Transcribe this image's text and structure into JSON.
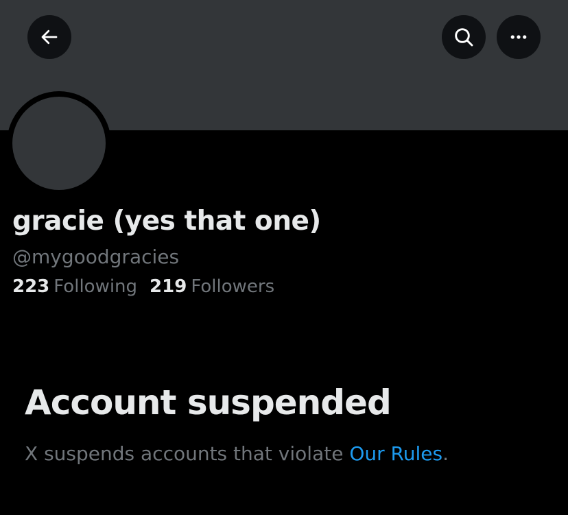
{
  "header": {
    "back_icon": "arrow-left-icon",
    "search_icon": "search-icon",
    "more_icon": "more-horizontal-icon"
  },
  "profile": {
    "display_name": "gracie (yes that one)",
    "handle": "@mygoodgracies",
    "following_count": "223",
    "following_label": "Following",
    "followers_count": "219",
    "followers_label": "Followers"
  },
  "suspension": {
    "title": "Account suspended",
    "message": "X suspends accounts that violate ",
    "rules_link": "Our Rules",
    "period": "."
  },
  "colors": {
    "background": "#000000",
    "banner": "#333639",
    "primary_text": "#e7e9ea",
    "secondary_text": "#71767b",
    "link": "#1d9bf0"
  }
}
